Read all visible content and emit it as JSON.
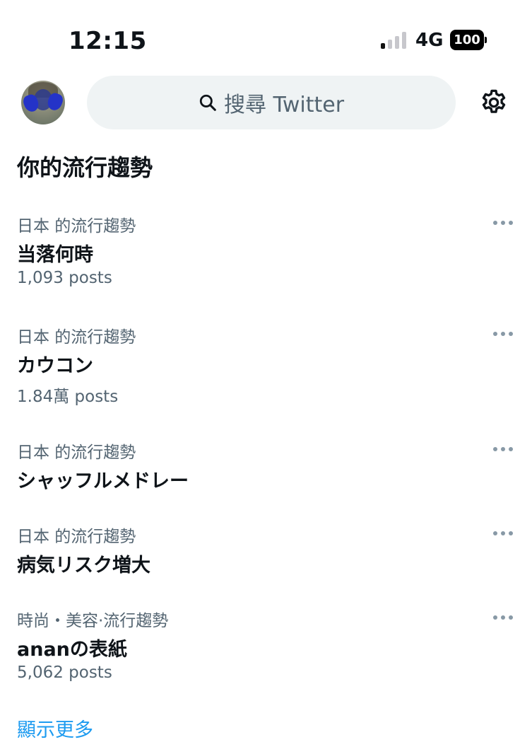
{
  "status_bar": {
    "time": "12:15",
    "network": "4G",
    "battery": "100"
  },
  "header": {
    "search_placeholder": "搜尋 Twitter",
    "avatar_icon": "user-avatar",
    "settings_icon": "gear-icon"
  },
  "section_title": "你的流行趨勢",
  "trends": [
    {
      "context": "日本 的流行趨勢",
      "name": "当落何時",
      "count": "1,093 posts"
    },
    {
      "context": "日本 的流行趨勢",
      "name": "カウコン",
      "count": "1.84萬 posts"
    },
    {
      "context": "日本 的流行趨勢",
      "name": "シャッフルメドレー",
      "count": ""
    },
    {
      "context": "日本 的流行趨勢",
      "name": "病気リスク増大",
      "count": ""
    },
    {
      "context": "時尚・美容·流行趨勢",
      "name": "ananの表紙",
      "count": "5,062 posts"
    }
  ],
  "show_more": "顯示更多",
  "colors": {
    "accent": "#1d9bf0",
    "secondary_text": "#536471",
    "search_bg": "#eff3f4"
  }
}
